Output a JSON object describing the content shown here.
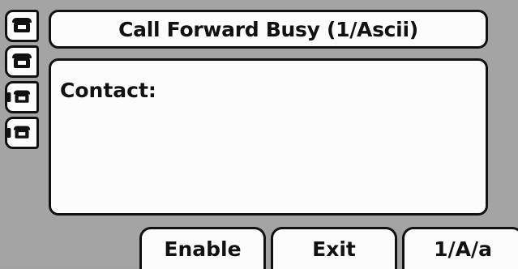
{
  "title": "Call Forward Busy (1/Ascii)",
  "form": {
    "contact_label": "Contact:",
    "contact_value": ""
  },
  "line_keys": [
    {
      "icon": "phone-handset-icon"
    },
    {
      "icon": "phone-handset-icon"
    },
    {
      "icon": "phone-handset-icon"
    },
    {
      "icon": "phone-handset-icon"
    }
  ],
  "softkeys": {
    "enable": "Enable",
    "exit": "Exit",
    "mode": "1/A/a"
  }
}
